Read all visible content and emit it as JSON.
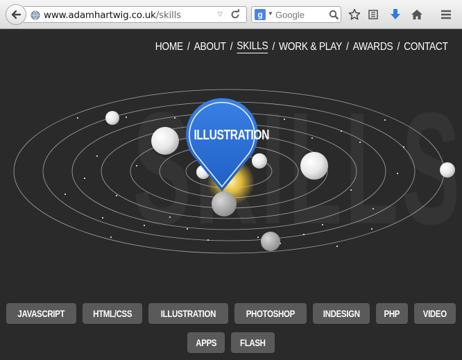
{
  "browser": {
    "url_domain": "www.adamhartwig.co.uk",
    "url_path": "/skills",
    "search_placeholder": "Google",
    "search_engine_letter": "g"
  },
  "nav": {
    "items": [
      "HOME",
      "ABOUT",
      "SKILLS",
      "WORK & PLAY",
      "AWARDS",
      "CONTACT"
    ],
    "active": "SKILLS"
  },
  "hero": {
    "watermark": "SKILLS",
    "pin_label": "ILLUSTRATION"
  },
  "skills": {
    "row1": [
      "JAVASCRIPT",
      "HTML/CSS",
      "ILLUSTRATION",
      "PHOTOSHOP",
      "INDESIGN",
      "PHP",
      "VIDEO"
    ],
    "row2": [
      "APPS",
      "FLASH"
    ]
  },
  "colors": {
    "pin": "#2a6fd6",
    "sun": "#f2d25a",
    "background": "#2a2a2a"
  }
}
